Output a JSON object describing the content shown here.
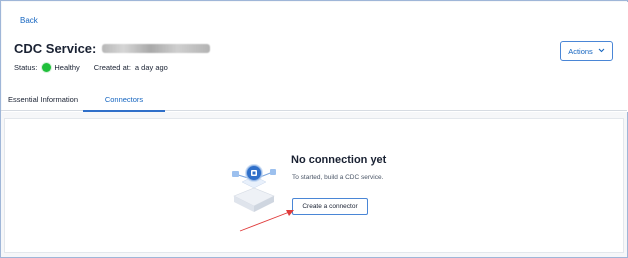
{
  "nav": {
    "back_label": "Back"
  },
  "header": {
    "title": "CDC Service:",
    "status_label": "Status:",
    "status_value": "Healthy",
    "created_label": "Created at:",
    "created_value": "a day ago",
    "actions_label": "Actions",
    "actions_icon": "chevron-down-icon"
  },
  "tabs": [
    {
      "label": "Essential Information",
      "active": false
    },
    {
      "label": "Connectors",
      "active": true
    }
  ],
  "empty_state": {
    "illustration_icon": "cube-connector-illustration",
    "title": "No connection yet",
    "subtitle": "To started, build a CDC service.",
    "button_label": "Create a connector"
  },
  "colors": {
    "accent": "#1565c0",
    "status_healthy": "#1fbf3a",
    "annotation_arrow": "#e03b3b"
  }
}
